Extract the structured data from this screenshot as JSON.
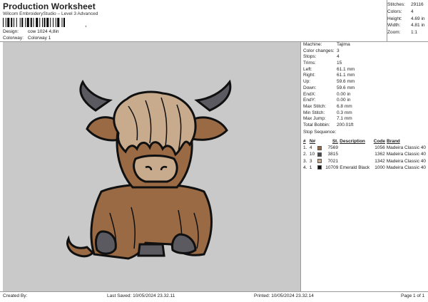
{
  "header": {
    "title": "Production Worksheet",
    "subtitle": "Wilcom EmbroideryStudio – Level 3 Advanced",
    "barcode_tail": ",",
    "design_label": "Design:",
    "design_value": "cow 1024 4,8in",
    "colorway_label": "Colorway:",
    "colorway_value": "Colorway 1"
  },
  "stats": [
    {
      "label": "Stitches:",
      "value": "29116"
    },
    {
      "label": "Colors:",
      "value": "4"
    },
    {
      "label": "Height:",
      "value": "4.69 in"
    },
    {
      "label": "Width:",
      "value": "4.81 in"
    },
    {
      "label": "Zoom:",
      "value": "1:1"
    }
  ],
  "info": [
    {
      "label": "Machine:",
      "value": "Tajima"
    },
    {
      "label": "Color changes:",
      "value": "3"
    },
    {
      "label": "Stops:",
      "value": "4"
    },
    {
      "label": "Trims:",
      "value": "15"
    },
    {
      "label": "Left:",
      "value": "61.1 mm"
    },
    {
      "label": "Right:",
      "value": "61.1 mm"
    },
    {
      "label": "Up:",
      "value": "59.6 mm"
    },
    {
      "label": "Down:",
      "value": "59.6 mm"
    },
    {
      "label": "EndX:",
      "value": "0.00 in"
    },
    {
      "label": "EndY:",
      "value": "0.00 in"
    },
    {
      "label": "Max Stitch:",
      "value": "6.8 mm"
    },
    {
      "label": "Min Stitch:",
      "value": "0.3 mm"
    },
    {
      "label": "Max Jump:",
      "value": "7.1 mm"
    },
    {
      "label": "Total Bobbin:",
      "value": "200.01ft"
    }
  ],
  "stop_sequence": {
    "title": "Stop Sequence:",
    "headers": {
      "idx": "#",
      "n": "N#",
      "st": "St.",
      "desc": "Description",
      "code": "Code",
      "brand": "Brand"
    },
    "rows": [
      {
        "idx": "1.",
        "n": "4",
        "color": "#9a6a44",
        "st": "7569",
        "desc": "",
        "code": "1056",
        "brand": "Madeira Classic 40"
      },
      {
        "idx": "2.",
        "n": "10",
        "color": "#4a4a52",
        "st": "3815",
        "desc": "",
        "code": "1362",
        "brand": "Madeira Classic 40"
      },
      {
        "idx": "3.",
        "n": "3",
        "color": "#c8aa8c",
        "st": "7021",
        "desc": "",
        "code": "1342",
        "brand": "Madeira Classic 40"
      },
      {
        "idx": "4.",
        "n": "1",
        "color": "#101010",
        "st": "10709",
        "desc": "Emerald Black",
        "code": "1000",
        "brand": "Madeira Classic 40"
      }
    ]
  },
  "footer": {
    "created_by": "Created By:",
    "last_saved": "Last Saved: 10/05/2024 23.32.11",
    "printed": "Printed: 10/05/2024 23.32.14",
    "page": "Page 1 of 1"
  },
  "colors": {
    "canvas_bg": "#c9c9c9",
    "fur_brown": "#9a6a44",
    "hair_tan": "#c8aa8c",
    "horn_gray": "#5a5a60",
    "outline": "#101010"
  }
}
